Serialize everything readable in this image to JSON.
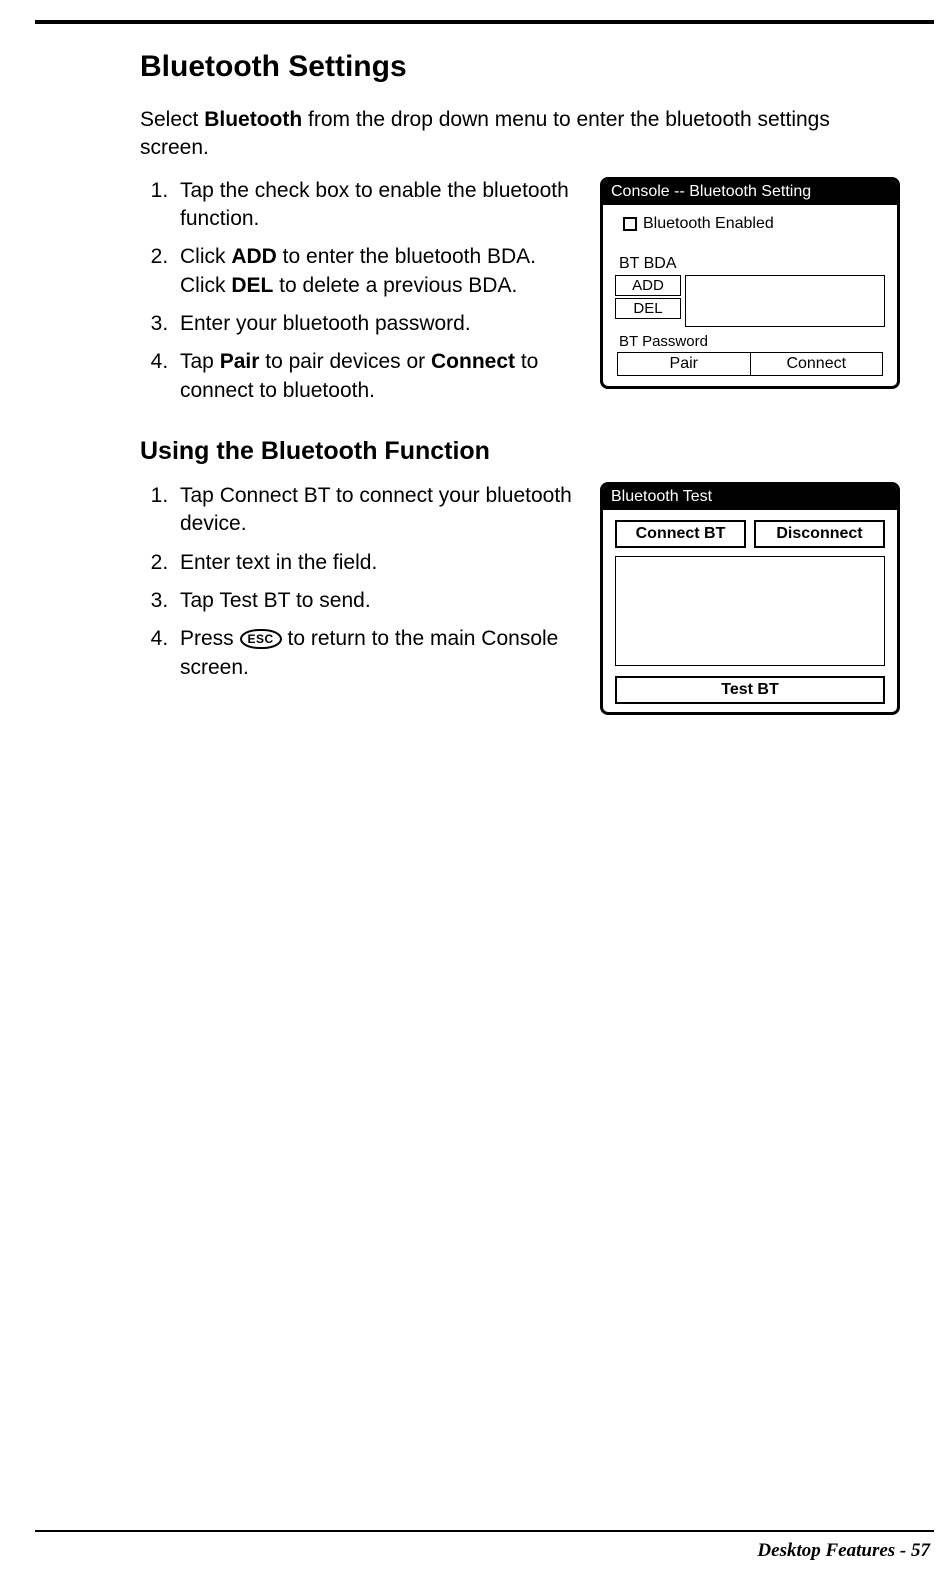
{
  "heading": "Bluetooth Settings",
  "intro_pre": "Select ",
  "intro_bold": "Bluetooth",
  "intro_post": " from the drop down menu to enter the bluetooth settings screen.",
  "steps1": {
    "s1": "Tap the check box to enable the blue­tooth function.",
    "s2_pre": "Click ",
    "s2_b1": "ADD",
    "s2_mid": " to enter the bluetooth BDA. Click ",
    "s2_b2": "DEL",
    "s2_post": " to delete a previous BDA.",
    "s3": "Enter your bluetooth password.",
    "s4_pre": "Tap ",
    "s4_b1": "Pair",
    "s4_mid": " to pair devices or ",
    "s4_b2": "Connect",
    "s4_post": " to connect to bluetooth."
  },
  "panel1": {
    "title": "Console -- Bluetooth Setting",
    "enabled_label": "Bluetooth Enabled",
    "bda_label": "BT BDA",
    "add": "ADD",
    "del": "DEL",
    "pw_label": "BT Password",
    "pair": "Pair",
    "connect": "Connect"
  },
  "subheading": "Using the Bluetooth Function",
  "steps2": {
    "s1": "Tap Connect BT to connect your blue­tooth device.",
    "s2": "Enter text in the field.",
    "s3": "Tap Test BT to send.",
    "s4_pre": "Press ",
    "s4_esc": "ESC",
    "s4_post": " to return to the main Console screen."
  },
  "panel2": {
    "title": "Bluetooth Test",
    "connect": "Connect BT",
    "disconnect": "Disconnect",
    "test": "Test BT"
  },
  "footer": "Desktop Features - 57"
}
